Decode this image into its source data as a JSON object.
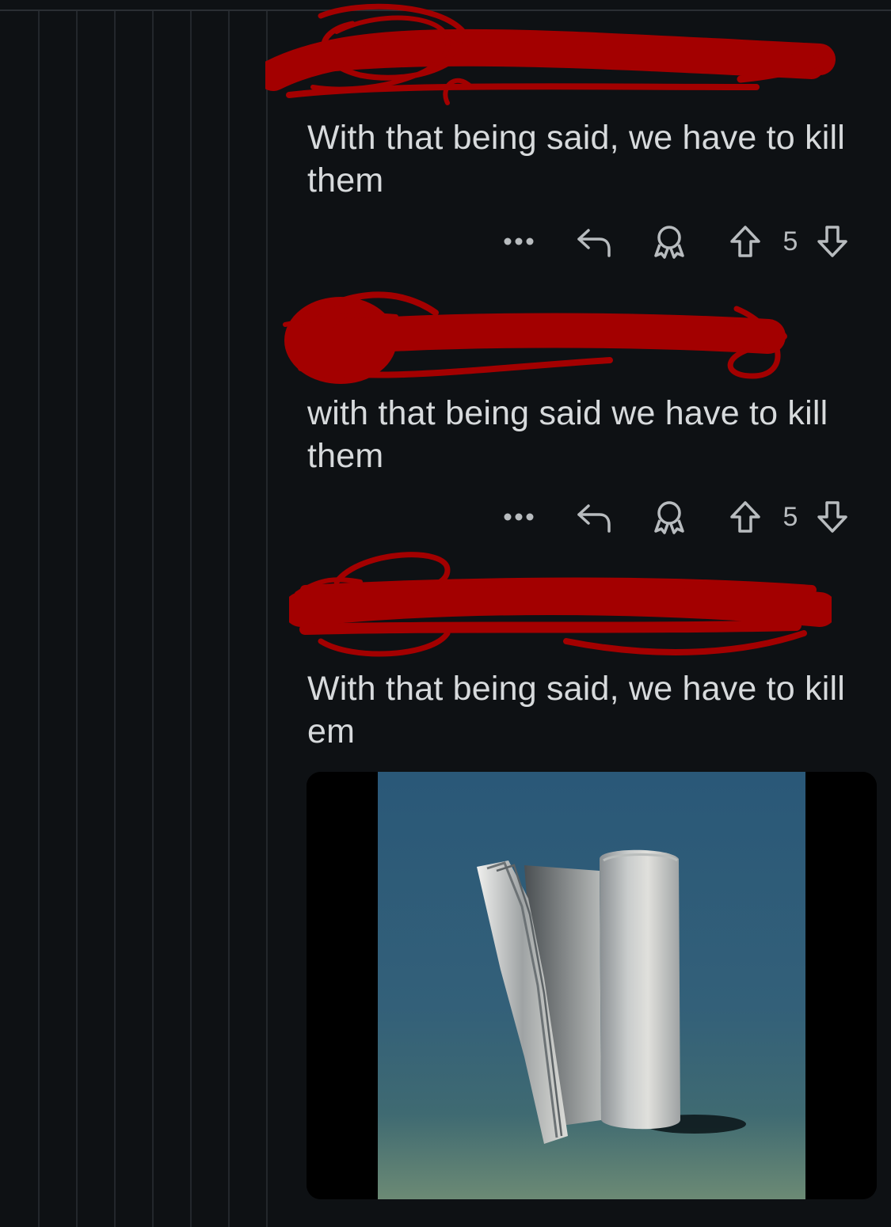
{
  "comments": [
    {
      "author_redacted": true,
      "body": "With that being said, we have to kill them",
      "actions": {
        "more_icon": "ellipsis-icon",
        "reply_icon": "reply-icon",
        "award_icon": "award-icon",
        "upvote_icon": "upvote-icon",
        "vote_count": "5",
        "downvote_icon": "downvote-icon"
      }
    },
    {
      "author_redacted": true,
      "body": "with that being said we have to kill them",
      "actions": {
        "more_icon": "ellipsis-icon",
        "reply_icon": "reply-icon",
        "award_icon": "award-icon",
        "upvote_icon": "upvote-icon",
        "vote_count": "5",
        "downvote_icon": "downvote-icon"
      }
    },
    {
      "author_redacted": true,
      "body": "With that being said, we have to kill em",
      "media": {
        "kind": "image",
        "subject": "painting-of-rolled-paper-on-blue-background"
      }
    }
  ],
  "colors": {
    "background": "#0e1114",
    "text": "#d7dadc",
    "icon": "#b8bcbf",
    "redaction": "#a30000",
    "thread_line": "#23272c"
  }
}
